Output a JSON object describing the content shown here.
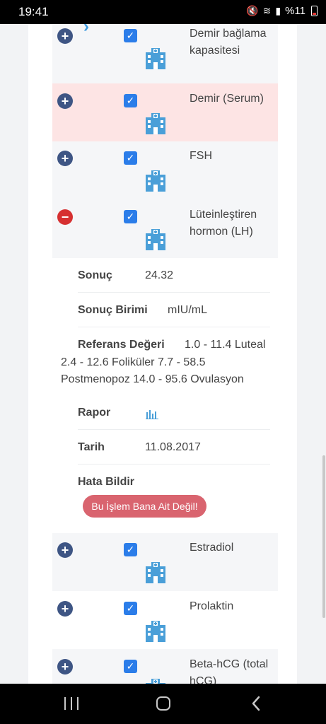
{
  "status_bar": {
    "time": "19:41",
    "battery": "%11"
  },
  "tests": [
    {
      "name": "Demir bağlama kapasitesi",
      "expanded": false,
      "has_chevron": true,
      "status": "normal"
    },
    {
      "name": "Demir (Serum)",
      "expanded": false,
      "status": "alert"
    },
    {
      "name": "FSH",
      "expanded": false,
      "status": "normal"
    },
    {
      "name": "Lüteinleştiren hormon (LH)",
      "expanded": true,
      "status": "normal"
    },
    {
      "name": "Estradiol",
      "expanded": false,
      "status": "normal"
    },
    {
      "name": "Prolaktin",
      "expanded": false,
      "status": "normal"
    },
    {
      "name": "Beta-hCG (total hCG)",
      "expanded": false,
      "status": "normal"
    }
  ],
  "detail": {
    "result_label": "Sonuç",
    "result_value": "24.32",
    "unit_label": "Sonuç Birimi",
    "unit_value": "mIU/mL",
    "reference_label": "Referans Değeri",
    "reference_value_first": "1.0 - 11.4 Luteal",
    "reference_value_rest": "2.4 - 12.6 Foliküler 7.7 - 58.5 Postmenopoz 14.0 - 95.6 Ovulasyon",
    "report_label": "Rapor",
    "date_label": "Tarih",
    "date_value": "11.08.2017",
    "error_label": "Hata Bildir",
    "error_button": "Bu İşlem Bana Ait Değil!"
  },
  "icons": {
    "expand": "plus-circle-icon",
    "collapse": "minus-circle-icon",
    "checkbox": "checkbox-checked-icon",
    "hospital": "hospital-building-icon",
    "report": "bar-chart-icon"
  },
  "colors": {
    "primary": "#3e5584",
    "check": "#2b7de9",
    "alert_row": "#fde4e4",
    "collapse": "#d63031",
    "error_button": "#d9646f",
    "hospital_icon": "#4a9fd8"
  }
}
